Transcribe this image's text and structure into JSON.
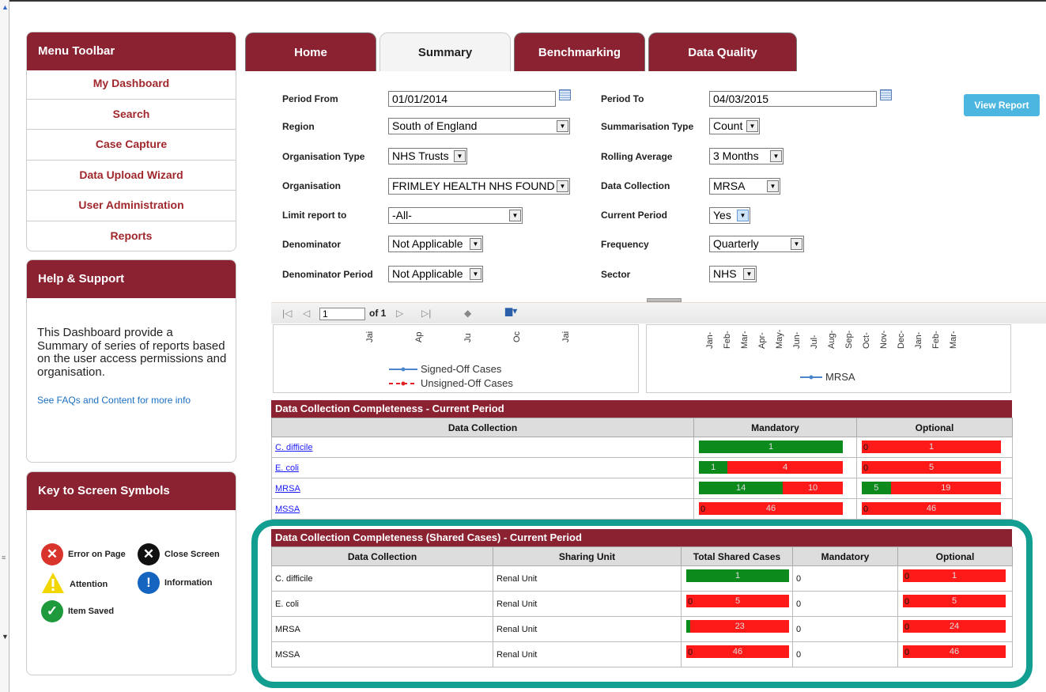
{
  "menu": {
    "title": "Menu Toolbar",
    "items": [
      "My Dashboard",
      "Search",
      "Case Capture",
      "Data Upload Wizard",
      "User Administration",
      "Reports"
    ]
  },
  "help": {
    "title": "Help & Support",
    "text": "This Dashboard provide a Summary of series of reports based on the user access permissions and organisation.",
    "link": "See FAQs and Content for more info"
  },
  "key": {
    "title": "Key to Screen Symbols",
    "items": [
      {
        "label": "Error on Page",
        "icon": "error-icon",
        "color": "#d9342b"
      },
      {
        "label": "Close Screen",
        "icon": "close-icon",
        "color": "#111111"
      },
      {
        "label": "Attention",
        "icon": "warning-icon",
        "color": "#f2d600"
      },
      {
        "label": "Information",
        "icon": "info-icon",
        "color": "#1565c0"
      },
      {
        "label": "Item Saved",
        "icon": "check-icon",
        "color": "#1e9a3c"
      }
    ]
  },
  "tabs": [
    "Home",
    "Summary",
    "Benchmarking",
    "Data Quality"
  ],
  "filters": {
    "period_from": {
      "label": "Period From",
      "value": "01/01/2014"
    },
    "period_to": {
      "label": "Period To",
      "value": "04/03/2015"
    },
    "region": {
      "label": "Region",
      "value": "South of England"
    },
    "summarisation_type": {
      "label": "Summarisation Type",
      "value": "Count"
    },
    "organisation_type": {
      "label": "Organisation Type",
      "value": "NHS Trusts"
    },
    "rolling_average": {
      "label": "Rolling Average",
      "value": "3 Months"
    },
    "organisation": {
      "label": "Organisation",
      "value": "FRIMLEY HEALTH NHS FOUND"
    },
    "data_collection": {
      "label": "Data Collection",
      "value": "MRSA"
    },
    "limit_report_to": {
      "label": "Limit report to",
      "value": "-All-"
    },
    "current_period": {
      "label": "Current Period",
      "value": "Yes"
    },
    "denominator": {
      "label": "Denominator",
      "value": "Not Applicable"
    },
    "frequency": {
      "label": "Frequency",
      "value": "Quarterly"
    },
    "denominator_period": {
      "label": "Denominator Period",
      "value": "Not Applicable"
    },
    "sector": {
      "label": "Sector",
      "value": "NHS"
    },
    "view_report": "View Report"
  },
  "report_toolbar": {
    "page": "1",
    "of": "of 1"
  },
  "chart_left": {
    "ticks": [
      "Jai",
      "Ap",
      "Ju",
      "Oc",
      "Jai"
    ],
    "legend": [
      "Signed-Off Cases",
      "Unsigned-Off Cases"
    ],
    "colors": [
      "#4a86c8",
      "#e02020"
    ]
  },
  "chart_right": {
    "ticks": [
      "Jan-",
      "Feb-",
      "Mar-",
      "Apr-",
      "May-",
      "Jun-",
      "Jul-",
      "Aug-",
      "Sep-",
      "Oct-",
      "Nov-",
      "Dec-",
      "Jan-",
      "Feb-",
      "Mar-"
    ],
    "legend": [
      "MRSA"
    ],
    "colors": [
      "#4a86c8"
    ]
  },
  "completeness": {
    "title": "Data Collection Completeness - Current Period",
    "headers": [
      "Data Collection",
      "Mandatory",
      "Optional"
    ],
    "rows": [
      {
        "name": "C. difficile",
        "mandatory": {
          "green": 1,
          "red": 0
        },
        "optional": {
          "green": 0,
          "red": 1
        }
      },
      {
        "name": "E. coli",
        "mandatory": {
          "green": 1,
          "red": 4
        },
        "optional": {
          "green": 0,
          "red": 5
        }
      },
      {
        "name": "MRSA",
        "mandatory": {
          "green": 14,
          "red": 10
        },
        "optional": {
          "green": 5,
          "red": 19
        }
      },
      {
        "name": "MSSA",
        "mandatory": {
          "green": 0,
          "red": 46
        },
        "optional": {
          "green": 0,
          "red": 46
        }
      }
    ]
  },
  "shared": {
    "title": "Data Collection Completeness (Shared Cases) - Current Period",
    "headers": [
      "Data Collection",
      "Sharing Unit",
      "Total Shared Cases",
      "Mandatory",
      "Optional"
    ],
    "rows": [
      {
        "name": "C. difficile",
        "unit": "Renal Unit",
        "total": {
          "green": 1,
          "red": 0
        },
        "mandatory": "0",
        "optional": {
          "green": 0,
          "red": 1
        }
      },
      {
        "name": "E. coli",
        "unit": "Renal Unit",
        "total": {
          "green": 0,
          "red": 5
        },
        "mandatory": "0",
        "optional": {
          "green": 0,
          "red": 5
        }
      },
      {
        "name": "MRSA",
        "unit": "Renal Unit",
        "total": {
          "green": 1,
          "red": 23
        },
        "mandatory": "0",
        "optional": {
          "green": 0,
          "red": 24
        }
      },
      {
        "name": "MSSA",
        "unit": "Renal Unit",
        "total": {
          "green": 0,
          "red": 46
        },
        "mandatory": "0",
        "optional": {
          "green": 0,
          "red": 46
        }
      }
    ]
  }
}
